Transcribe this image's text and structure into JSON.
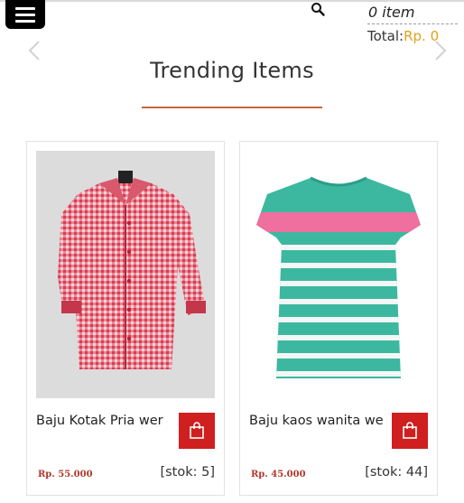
{
  "header": {
    "cart_count": "0 item",
    "cart_total_label": "Total:",
    "cart_total_amount": "Rp. 0"
  },
  "section": {
    "title": "Trending Items"
  },
  "products": [
    {
      "name": "Baju Kotak Pria wer",
      "price": "Rp. 55.000",
      "stock": "[stok: 5]",
      "image": "pink-checked-shirt"
    },
    {
      "name": "Baju kaos wanita we",
      "price": "Rp. 45.000",
      "stock": "[stok: 44]",
      "image": "striped-tshirt"
    }
  ],
  "colors": {
    "accent": "#c9643f",
    "cart_button": "#d01f1f",
    "price": "#b2382a",
    "total_amount": "#e0a21a"
  }
}
